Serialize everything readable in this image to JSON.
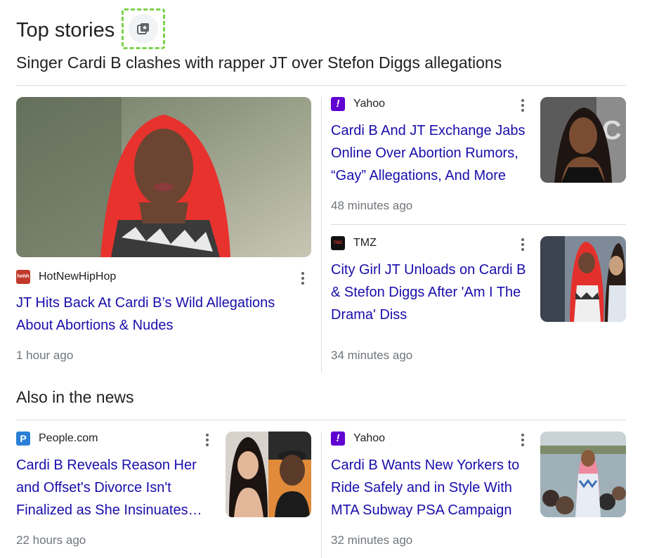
{
  "header": {
    "title": "Top stories",
    "icon": "stack-star-icon"
  },
  "cluster": {
    "title": "Singer Cardi B clashes with rapper JT over Stefon Diggs allegations",
    "main": {
      "source": "HotNewHipHop",
      "favicon_text": "hnhh",
      "headline": "JT Hits Back At Cardi B’s Wild Allegations About Abortions & Nudes",
      "time": "1 hour ago"
    },
    "side": [
      {
        "source": "Yahoo",
        "favicon_text": "!",
        "headline": "Cardi B And JT Exchange Jabs Online Over Abortion Rumors, “Gay” Allegations, And More",
        "time": "48 minutes ago"
      },
      {
        "source": "TMZ",
        "favicon_text": "TMZ",
        "headline": "City Girl JT Unloads on Cardi B & Stefon Diggs After 'Am I The Drama' Diss",
        "time": "34 minutes ago"
      }
    ]
  },
  "also": {
    "title": "Also in the news",
    "items": [
      {
        "source": "People.com",
        "favicon_text": "P",
        "headline": "Cardi B Reveals Reason Her and Offset's Divorce Isn't Finalized as She Insinuates He's Cheating",
        "time": "22 hours ago"
      },
      {
        "source": "Yahoo",
        "favicon_text": "!",
        "headline": "Cardi B Wants New Yorkers to Ride Safely and in Style With MTA Subway PSA Campaign",
        "time": "32 minutes ago"
      }
    ]
  },
  "colors": {
    "link": "#1a0dab",
    "yahoo": "#6001d2",
    "hnhh": "#c0392b",
    "people": "#2a7fd4",
    "tmz": "#111111"
  }
}
